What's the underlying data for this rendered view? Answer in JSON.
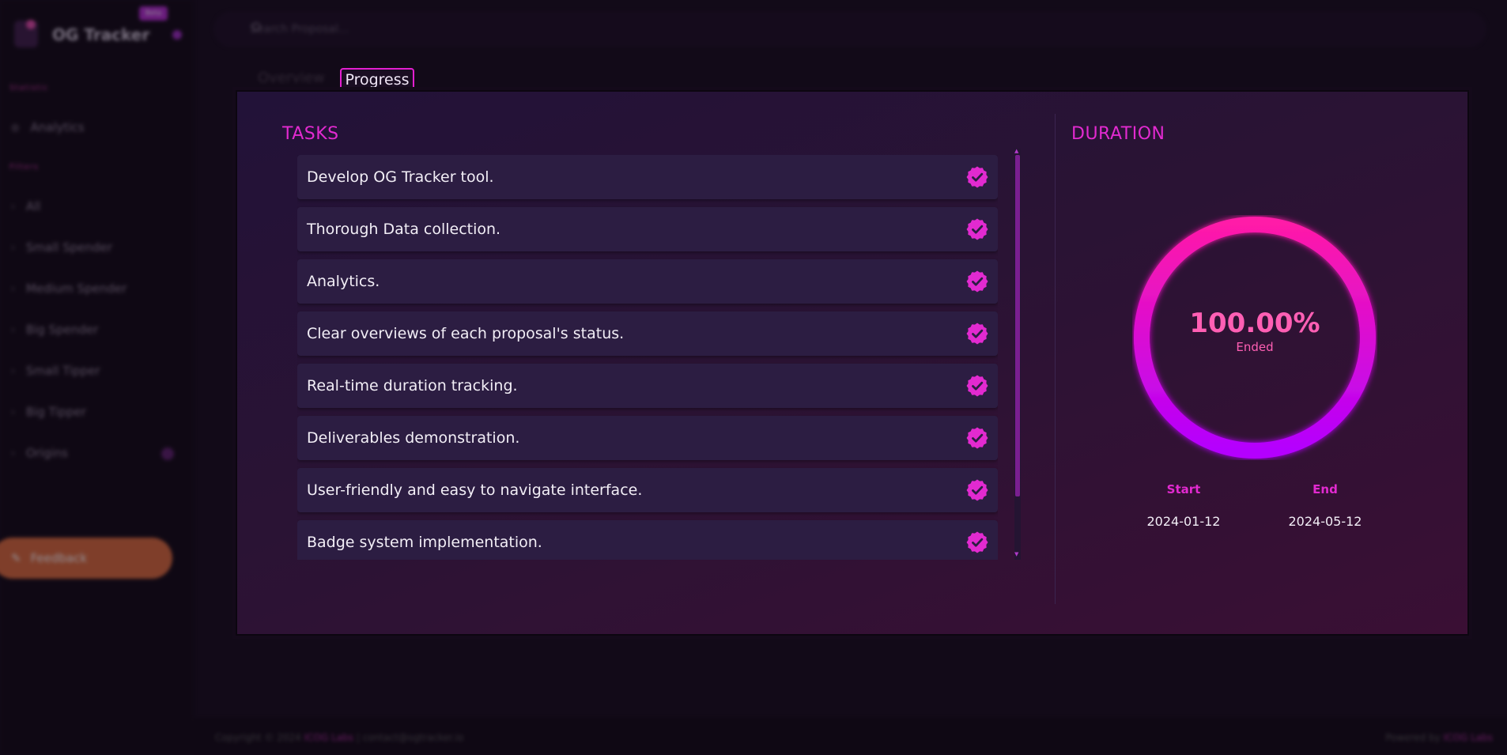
{
  "app": {
    "title": "OG Tracker",
    "badge": "Beta"
  },
  "search": {
    "placeholder": "Search Proposal..."
  },
  "sidebar": {
    "section_1": "Statistic",
    "analytics_label": "Analytics",
    "section_2": "Filters",
    "items": [
      {
        "label": "All"
      },
      {
        "label": "Small Spender"
      },
      {
        "label": "Medium Spender"
      },
      {
        "label": "Big Spender"
      },
      {
        "label": "Small Tipper"
      },
      {
        "label": "Big Tipper"
      },
      {
        "label": "Origins"
      }
    ],
    "feedback_label": "Feedback"
  },
  "tabs": {
    "overview": "Overview",
    "progress": "Progress"
  },
  "tasks": {
    "heading": "TASKS",
    "items": [
      "Develop OG Tracker tool.",
      "Thorough Data collection.",
      "Analytics.",
      "Clear overviews of each proposal's status.",
      "Real-time duration tracking.",
      "Deliverables demonstration.",
      "User-friendly and easy to navigate interface.",
      "Badge system implementation."
    ]
  },
  "duration": {
    "heading": "DURATION",
    "progress_percent": 100,
    "progress_text": "100.00%",
    "status": "Ended",
    "start_label": "Start",
    "start_date": "2024-01-12",
    "end_label": "End",
    "end_date": "2024-05-12"
  },
  "footer": {
    "copyright": "Copyright © 2024",
    "brand": "ICOG Labs",
    "contact": "| contact@ogtracker.io",
    "powered_prefix": "Powered by",
    "powered_brand": "ICOG Labs"
  },
  "colors": {
    "accent": "#e22ad0",
    "ring_start": "#b400ff",
    "ring_end": "#ff1aa8",
    "panel_bg": "#2a1334"
  },
  "icons": {
    "check": "badge-check-icon",
    "search": "search-icon",
    "chevron": "chevron-right-icon"
  }
}
